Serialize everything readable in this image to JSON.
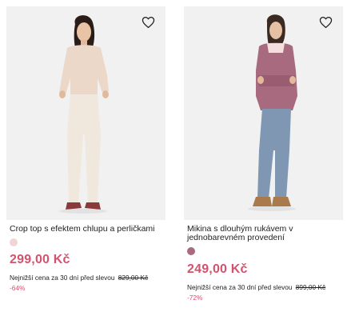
{
  "colors": {
    "accent": "#d4526e",
    "background": "#ffffff",
    "image_bg": "#f1f1f1"
  },
  "products": [
    {
      "name": "Crop top s efektem chlupu a perličkami",
      "swatch_color": "#f2d4d4",
      "price": "299,00 Kč",
      "lowest_label": "Nejnižší cena za 30 dní před slevou",
      "old_price": "829,00 Kč",
      "discount": "-64%",
      "wishlist_icon": "heart-outline-icon"
    },
    {
      "name": "Mikina s dlouhým rukávem v jednobarevném provedení",
      "swatch_color": "#a86a7e",
      "price": "249,00 Kč",
      "lowest_label": "Nejnižší cena za 30 dní před slevou",
      "old_price": "899,00 Kč",
      "discount": "-72%",
      "wishlist_icon": "heart-outline-icon"
    }
  ]
}
